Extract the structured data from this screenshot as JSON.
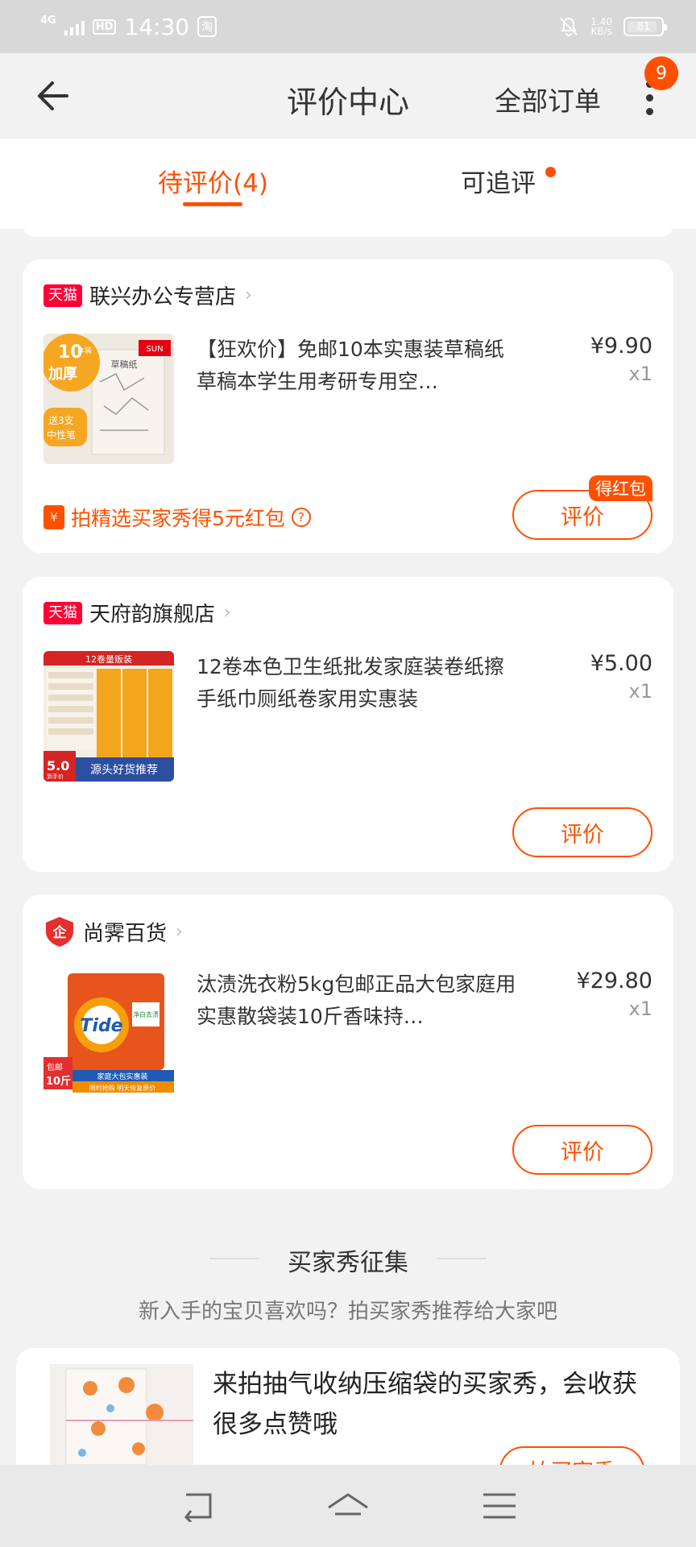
{
  "status": {
    "network": "4G",
    "hd": "HD",
    "time": "14:30",
    "app_badge": "淘",
    "speed": "1.40",
    "speed_unit": "KB/s",
    "battery": "81"
  },
  "header": {
    "title": "评价中心",
    "all_orders": "全部订单",
    "badge": "9"
  },
  "tabs": [
    {
      "label": "待评价(4)",
      "active": true
    },
    {
      "label": "可追评",
      "dot": true
    }
  ],
  "orders": [
    {
      "shop": "联兴办公专营店",
      "badge": "天猫",
      "title": "【狂欢价】免邮10本实惠装草稿纸草稿本学生用考研专用空…",
      "price": "¥9.90",
      "qty": "x1",
      "promo": "拍精选买家秀得5元红包",
      "tag": "得红包",
      "button": "评价",
      "thumb_text": [
        "10本装",
        "加厚",
        "送3支中性笔",
        "SUN",
        "草稿纸"
      ]
    },
    {
      "shop": "天府韵旗舰店",
      "badge": "天猫",
      "title": "12卷本色卫生纸批发家庭装卷纸擦手纸巾厕纸卷家用实惠装",
      "price": "¥5.00",
      "qty": "x1",
      "button": "评价",
      "thumb_text": [
        "12卷量贩装",
        "5.0",
        "到手价",
        "源头好货推荐"
      ]
    },
    {
      "shop": "尚霁百货",
      "badge": "企",
      "title": "汰渍洗衣粉5kg包邮正品大包家庭用实惠散袋装10斤香味持…",
      "price": "¥29.80",
      "qty": "x1",
      "button": "评价",
      "thumb_text": [
        "Tide",
        "净白去渍",
        "包邮",
        "10斤",
        "家庭大包实惠装",
        "限时抢购 明天恢复原价"
      ]
    }
  ],
  "section": {
    "title": "买家秀征集",
    "subtitle": "新入手的宝贝喜欢吗？拍买家秀推荐给大家吧"
  },
  "show": {
    "text": "来拍抽气收纳压缩袋的买家秀，会收获很多点赞哦",
    "button": "拍买家秀"
  },
  "colors": {
    "accent": "#ff5000",
    "tmall": "#ff0036"
  }
}
